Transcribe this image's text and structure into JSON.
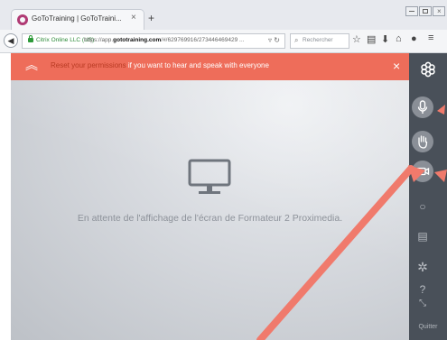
{
  "browser": {
    "tab_title": "GoToTraining | GoToTraini...",
    "tab_close": "×",
    "new_tab": "+",
    "site_identity": "Citrix Online LLC (US)",
    "url_prefix": "https://app.",
    "url_domain": "gototraining.com",
    "url_rest": "/#/629769916/273446469429 ...",
    "search_placeholder": "Rechercher",
    "nav_icons": [
      "star-icon",
      "clipboard-icon",
      "download-icon",
      "home-icon",
      "chat-icon",
      "menu-icon"
    ]
  },
  "banner": {
    "link_text": "Reset your permissions",
    "text": " if you want to hear and speak with everyone",
    "close": "×",
    "color": "#ee6d5a"
  },
  "main": {
    "waiting_text": "En attente de l'affichage de l'écran de Formateur 2 Proximedia."
  },
  "sidebar": {
    "icons": [
      "logo-icon",
      "microphone-icon",
      "hand-icon",
      "camera-icon",
      "chat-icon",
      "notes-icon",
      "settings-icon",
      "help-icon",
      "fullscreen-icon"
    ],
    "quit_label": "Quitter"
  },
  "colors": {
    "accent": "#ee6d5a",
    "sidebar": "#495059",
    "annotation": "#f07a6c"
  }
}
